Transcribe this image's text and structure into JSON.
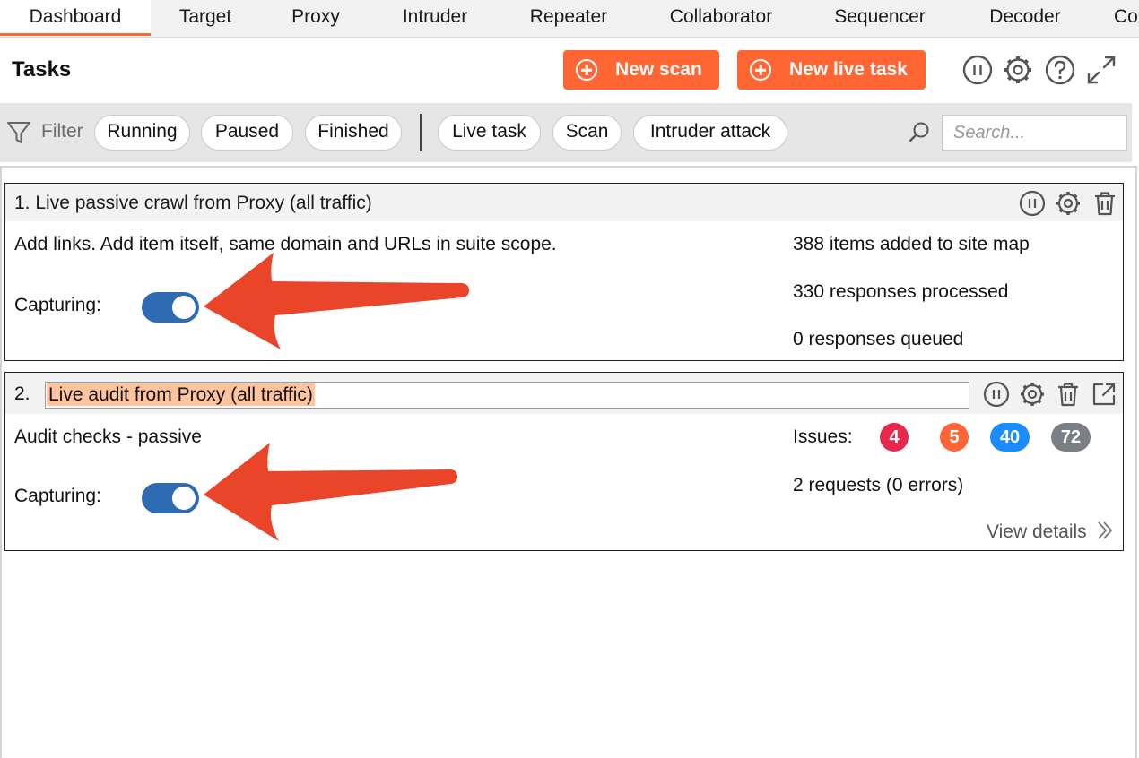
{
  "tabs": [
    "Dashboard",
    "Target",
    "Proxy",
    "Intruder",
    "Repeater",
    "Collaborator",
    "Sequencer",
    "Decoder",
    "Co"
  ],
  "active_tab": "Dashboard",
  "header": {
    "title": "Tasks",
    "new_scan_label": "New scan",
    "new_live_task_label": "New live task"
  },
  "filter": {
    "label": "Filter",
    "status_chips": [
      "Running",
      "Paused",
      "Finished"
    ],
    "type_chips": [
      "Live task",
      "Scan",
      "Intruder attack"
    ],
    "search_placeholder": "Search..."
  },
  "tasks": [
    {
      "number": "1.",
      "name": "Live passive crawl from Proxy (all traffic)",
      "description": "Add links. Add item itself, same domain and URLs in suite scope.",
      "capturing_label": "Capturing:",
      "capturing": true,
      "stats": [
        "388 items added to site map",
        "330 responses processed",
        "0 responses queued"
      ]
    },
    {
      "number": "2.",
      "name": "Live audit from Proxy (all traffic)",
      "description": "Audit checks - passive",
      "capturing_label": "Capturing:",
      "capturing": true,
      "issues_label": "Issues:",
      "issues": [
        {
          "count": "4",
          "severity": "high",
          "color": "#e8274b"
        },
        {
          "count": "5",
          "severity": "medium",
          "color": "#ff6633"
        },
        {
          "count": "40",
          "severity": "low",
          "color": "#1a8cff"
        },
        {
          "count": "72",
          "severity": "info",
          "color": "#7a7f86"
        }
      ],
      "requests_text": "2 requests (0 errors)",
      "view_details_label": "View details"
    }
  ],
  "colors": {
    "accent": "#ff6633",
    "toggle_on": "#2e6bb2",
    "annotation_arrow": "#ea4429",
    "title_highlight": "#ffc49e"
  }
}
